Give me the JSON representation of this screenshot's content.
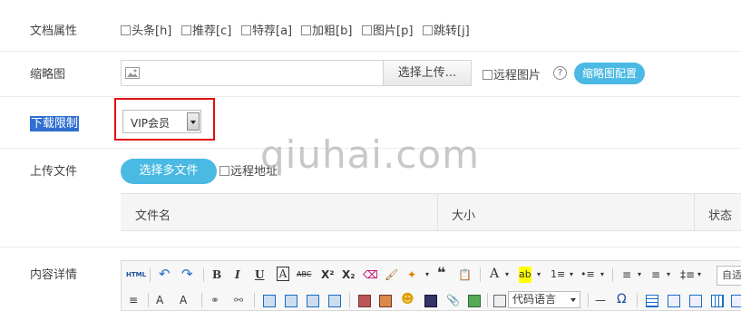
{
  "rows": {
    "doc_props": {
      "label": "文档属性",
      "flags": [
        "头条[h]",
        "推荐[c]",
        "特荐[a]",
        "加粗[b]",
        "图片[p]",
        "跳转[j]"
      ]
    },
    "thumbnail": {
      "label": "缩略图",
      "upload_label": "选择上传...",
      "remote_label": "远程图片",
      "help": "?",
      "config_label": "缩略图配置"
    },
    "download": {
      "label": "下载限制",
      "selected": "VIP会员"
    },
    "upload": {
      "label": "上传文件",
      "multi_label": "选择多文件",
      "remote_label": "远程地址",
      "columns": [
        "文件名",
        "大小",
        "状态"
      ]
    },
    "content": {
      "label": "内容详情"
    }
  },
  "watermark": "qiuhai.com",
  "editor": {
    "row1": [
      "HTML",
      "↶",
      "↷",
      "B",
      "I",
      "U",
      "A",
      "ABC",
      "X²",
      "X₂",
      "⌫",
      "🖌",
      "✦",
      "❝",
      "📋",
      "A",
      "ab",
      "1≡",
      "•≡",
      "≡",
      "≡",
      "‡≡"
    ],
    "code_language": "代码语言",
    "auto": "自适"
  },
  "colors": {
    "accent": "#4ab9e3",
    "highlight": "#2f6fd0",
    "red_frame": "#e01010"
  }
}
